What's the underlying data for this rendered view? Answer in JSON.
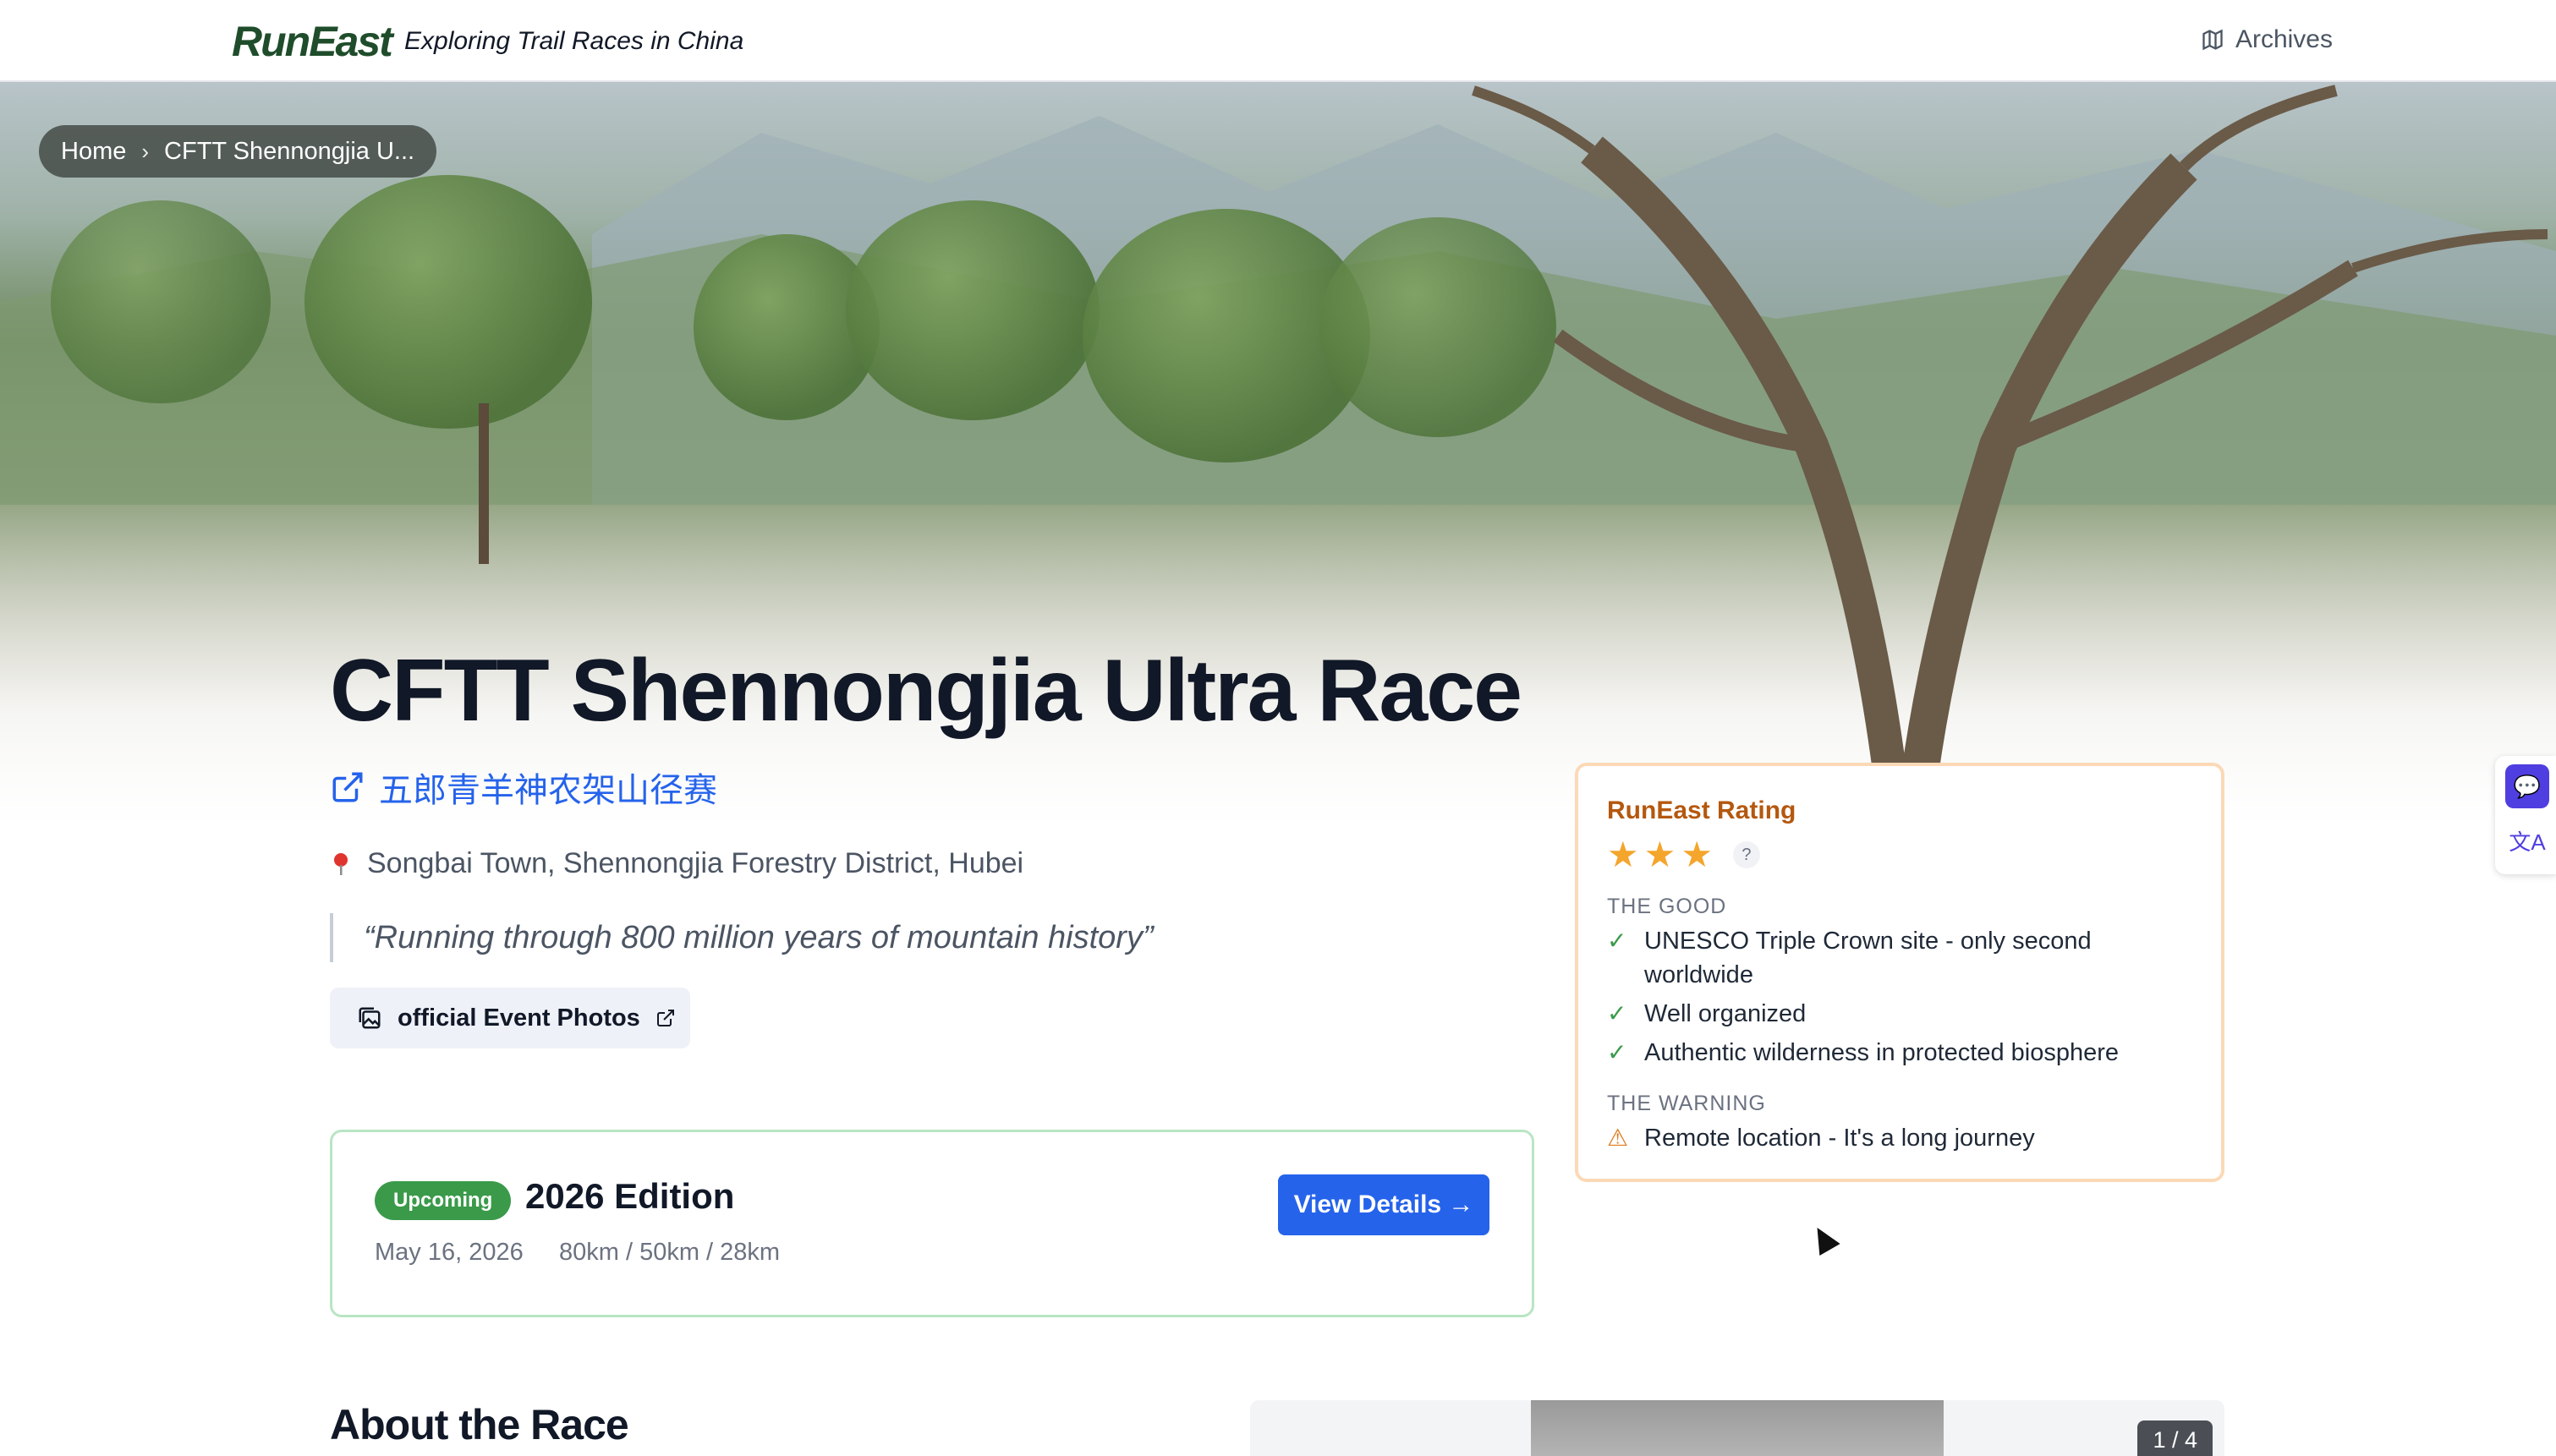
{
  "nav": {
    "logo": "RunEast",
    "tagline": "Exploring Trail Races in China",
    "archives_label": "Archives",
    "archives_icon": "map-icon"
  },
  "breadcrumb": {
    "home": "Home",
    "separator": "›",
    "current": "CFTT Shennongjia U..."
  },
  "race": {
    "title": "CFTT Shennongjia Ultra Race",
    "chinese_name": "五郎青羊神农架山径赛",
    "location": "Songbai Town, Shennongjia Forestry District, Hubei",
    "quote": "“Running through 800 million years of mountain history”",
    "photos_button": "official Event Photos"
  },
  "edition": {
    "status": "Upcoming",
    "title": "2026 Edition",
    "date": "May 16, 2026",
    "distances": "80km / 50km / 28km",
    "button": "View Details →"
  },
  "rating": {
    "title": "RunEast Rating",
    "stars": 3,
    "help": "?",
    "good_label": "THE GOOD",
    "good": [
      "UNESCO Triple Crown site - only second worldwide",
      "Well organized",
      "Authentic wilderness in protected biosphere"
    ],
    "warning_label": "THE WARNING",
    "warnings": [
      "Remote location - It's a long journey"
    ]
  },
  "about": {
    "title": "About the Race",
    "gallery_counter": "1 / 4"
  },
  "colors": {
    "brand_green": "#1f4d2b",
    "link_blue": "#2563eb",
    "status_green": "#3a9a4a",
    "rating_orange": "#b4580f",
    "star": "#f4a52b"
  }
}
